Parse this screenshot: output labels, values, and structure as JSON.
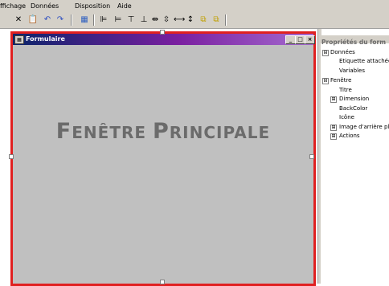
{
  "menu": [
    {
      "label": "ffichage"
    },
    {
      "label": "Données"
    },
    {
      "label": "Disposition"
    },
    {
      "label": "Aide"
    }
  ],
  "toolbar": [
    {
      "icon": "cut-icon"
    },
    {
      "icon": "paste-icon"
    },
    {
      "icon": "undo-icon"
    },
    {
      "icon": "redo-icon"
    },
    {
      "icon": "grid-icon"
    },
    {
      "icon": "align-left-icon"
    },
    {
      "icon": "align-right-icon"
    },
    {
      "icon": "align-top-icon"
    },
    {
      "icon": "align-bottom-icon"
    },
    {
      "icon": "center-horizontal-icon"
    },
    {
      "icon": "center-vertical-icon"
    },
    {
      "icon": "space-horizontal-icon"
    },
    {
      "icon": "space-vertical-icon"
    },
    {
      "icon": "bring-front-icon"
    },
    {
      "icon": "send-back-icon"
    }
  ],
  "form": {
    "window_title": "Formulaire",
    "heading_part1_cap": "F",
    "heading_part1_rest": "ENÊTRE ",
    "heading_part2_cap": "P",
    "heading_part2_rest": "RINCIPALE",
    "minimize": "_",
    "maximize": "□",
    "close": "×"
  },
  "properties": {
    "title": "Propriétés du form",
    "rows": [
      {
        "label": "Données",
        "type": "group",
        "expander": "⊟"
      },
      {
        "label": "Etiquette attachée",
        "type": "item"
      },
      {
        "label": "Variables",
        "type": "item"
      },
      {
        "label": "Fenêtre",
        "type": "group",
        "expander": "⊟"
      },
      {
        "label": "Titre",
        "type": "item"
      },
      {
        "label": "Dimension",
        "type": "subgroup",
        "expander": "⊞"
      },
      {
        "label": "BackColor",
        "type": "item"
      },
      {
        "label": "Icône",
        "type": "item"
      },
      {
        "label": "Image d'arrière pla",
        "type": "subgroup",
        "expander": "⊞"
      },
      {
        "label": "Actions",
        "type": "subgroup",
        "expander": "⊞"
      }
    ]
  },
  "colors": {
    "selection_border": "#e02020",
    "form_background": "#c0c0c0",
    "heading_color": "#6b6b6b"
  }
}
